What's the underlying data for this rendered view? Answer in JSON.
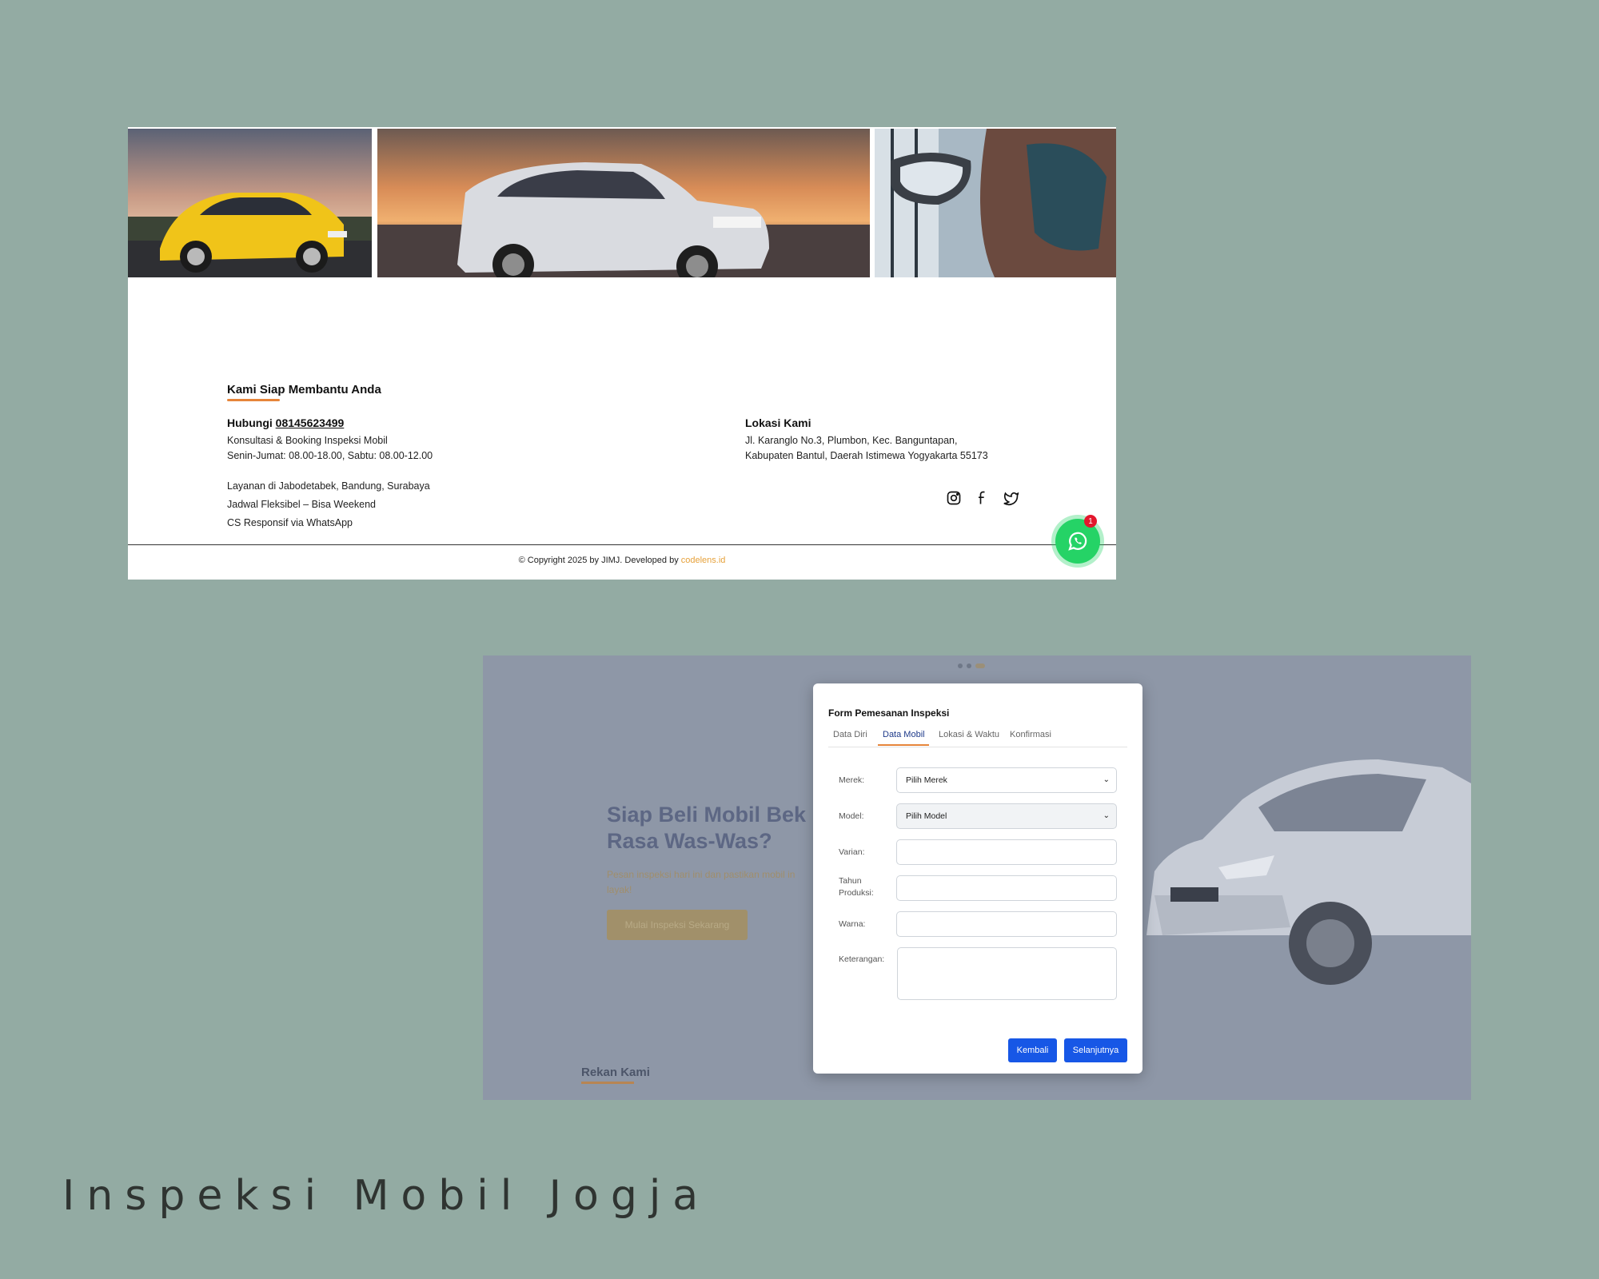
{
  "top_card": {
    "help_title": "Kami Siap Membantu Anda",
    "contact_prefix": "Hubungi",
    "phone": "08145623499",
    "contact_lines": [
      "Konsultasi & Booking Inspeksi Mobil",
      "Senin-Jumat: 08.00-18.00, Sabtu: 08.00-12.00"
    ],
    "service_lines": [
      "Layanan di Jabodetabek, Bandung, Surabaya",
      "Jadwal Fleksibel – Bisa Weekend",
      "CS Responsif via WhatsApp"
    ],
    "location_title": "Lokasi Kami",
    "location_lines": [
      "Jl. Karanglo No.3, Plumbon, Kec. Banguntapan,",
      "Kabupaten Bantul, Daerah Istimewa Yogyakarta 55173"
    ],
    "social_icons": [
      "instagram-icon",
      "facebook-icon",
      "twitter-icon"
    ],
    "copyright_text": "© Copyright 2025 by JIMJ. Developed by ",
    "developer": "codelens.id",
    "whatsapp_badge": "1",
    "colors": {
      "accent": "#e6853a",
      "whatsapp": "#25d366",
      "badge": "#e3172d"
    }
  },
  "bottom_card": {
    "hero_title": "Siap Beli Mobil Bek Rasa Was-Was?",
    "hero_subtitle": "Pesan inspeksi hari ini dan pastikan mobil in layak!",
    "hero_button": "Mulai Inspeksi Sekarang",
    "partners_title": "Rekan Kami"
  },
  "modal": {
    "title": "Form Pemesanan Inspeksi",
    "tabs": [
      "Data Diri",
      "Data Mobil",
      "Lokasi & Waktu",
      "Konfirmasi"
    ],
    "active_tab": "Data Mobil",
    "fields": {
      "merek": {
        "label": "Merek:",
        "value": "Pilih Merek"
      },
      "model": {
        "label": "Model:",
        "value": "Pilih Model"
      },
      "varian": {
        "label": "Varian:",
        "value": ""
      },
      "tahun": {
        "label": "Tahun Produksi:",
        "value": ""
      },
      "warna": {
        "label": "Warna:",
        "value": ""
      },
      "keterangan": {
        "label": "Keterangan:",
        "value": ""
      }
    },
    "back_button": "Kembali",
    "next_button": "Selanjutnya",
    "button_color": "#1757e6"
  },
  "caption": "Inspeksi Mobil Jogja"
}
